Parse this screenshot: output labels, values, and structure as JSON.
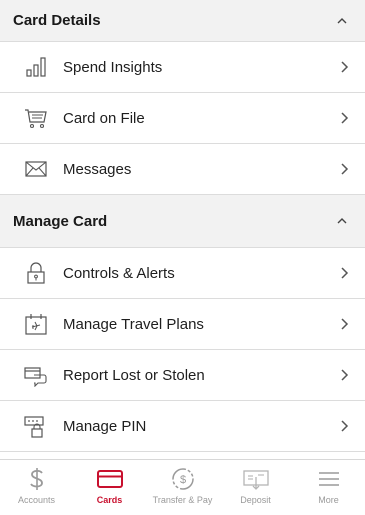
{
  "sections": [
    {
      "title": "Card Details",
      "items": [
        {
          "label": "Spend Insights",
          "icon": "bar-chart-icon"
        },
        {
          "label": "Card on File",
          "icon": "cart-icon"
        },
        {
          "label": "Messages",
          "icon": "envelope-icon"
        }
      ]
    },
    {
      "title": "Manage Card",
      "items": [
        {
          "label": "Controls & Alerts",
          "icon": "lock-icon"
        },
        {
          "label": "Manage Travel Plans",
          "icon": "calendar-plane-icon"
        },
        {
          "label": "Report Lost or Stolen",
          "icon": "lost-card-icon"
        },
        {
          "label": "Manage PIN",
          "icon": "pin-lock-icon"
        }
      ]
    }
  ],
  "tabbar": {
    "tabs": [
      {
        "label": "Accounts",
        "icon": "dollar-icon",
        "active": false
      },
      {
        "label": "Cards",
        "icon": "card-icon",
        "active": true
      },
      {
        "label": "Transfer & Pay",
        "icon": "transfer-icon",
        "active": false
      },
      {
        "label": "Deposit",
        "icon": "check-deposit-icon",
        "active": false
      },
      {
        "label": "More",
        "icon": "menu-icon",
        "active": false
      }
    ],
    "active_color": "#c8102e",
    "inactive_color": "#9a9a9a"
  }
}
